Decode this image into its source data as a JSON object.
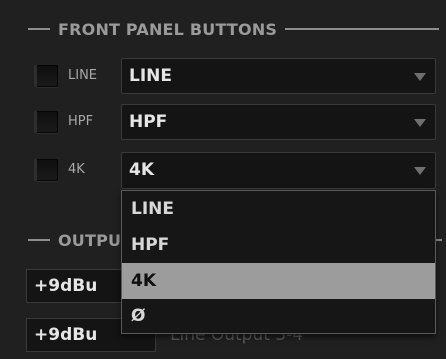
{
  "front_panel": {
    "title": "FRONT PANEL BUTTONS",
    "buttons": [
      {
        "label": "LINE",
        "value": "LINE"
      },
      {
        "label": "HPF",
        "value": "HPF"
      },
      {
        "label": "4K",
        "value": "4K"
      }
    ]
  },
  "dropdown": {
    "options": [
      "LINE",
      "HPF",
      "4K",
      "Ø"
    ],
    "highlighted": "4K"
  },
  "output": {
    "title_visible": "OUTPU",
    "rows": [
      {
        "level": "+9dBu",
        "caption": ""
      },
      {
        "level": "+9dBu",
        "caption": "Line Output 3-4"
      }
    ]
  },
  "icons": {
    "caret": "chevron-down-icon"
  },
  "colors": {
    "background": "#202020",
    "field_bg": "#141414",
    "highlight_bg": "#9c9c9c",
    "text": "#e6e6e6",
    "muted": "#9a9a9a"
  }
}
